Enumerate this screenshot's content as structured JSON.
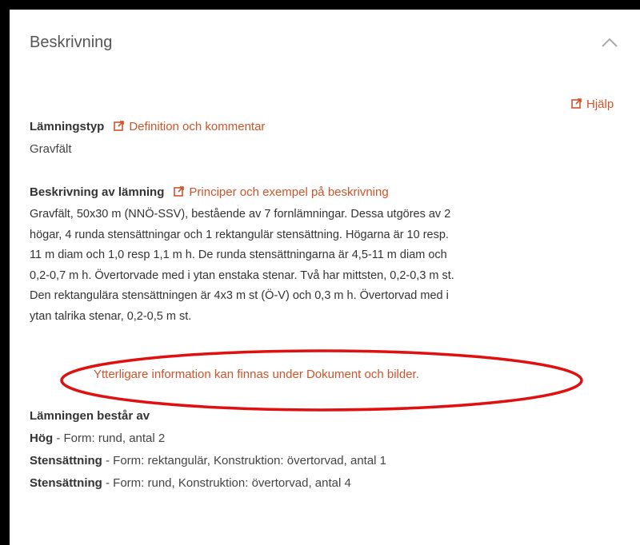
{
  "header": {
    "title": "Beskrivning"
  },
  "help_link": "Hjälp",
  "lamningstyp": {
    "label": "Lämningstyp",
    "link": "Definition och kommentar",
    "value": "Gravfält"
  },
  "beskrivning": {
    "label": "Beskrivning av lämning",
    "link": "Principer och exempel på beskrivning",
    "lines": [
      "Gravfält, 50x30 m (NNÖ-SSV), bestående av 7 fornlämningar. Dessa utgöres av 2",
      "högar, 4 runda stensättningar och 1 rektangulär stensättning. Högarna är 10 resp.",
      "11 m diam och 1,0 resp 1,1 m h. De runda stensättningarna är 4,5-11 m diam och",
      "0,2-0,7 m h. Övertorvade med i ytan enstaka stenar. Två har mittsten, 0,2-0,3 m st.",
      "Den rektangulära stensättningen är 4x3 m st (Ö-V) och 0,3 m h. Övertorvad med i",
      "ytan talrika stenar, 0,2-0,5 m st."
    ]
  },
  "note": "Ytterligare information kan finnas under Dokument och bilder.",
  "bestar": {
    "label": "Lämningen består av",
    "items": [
      {
        "name": "Hög",
        "detail": " - Form: rund, antal 2"
      },
      {
        "name": "Stensättning",
        "detail": " - Form: rektangulär, Konstruktion: övertorvad, antal 1"
      },
      {
        "name": "Stensättning",
        "detail": " - Form: rund, Konstruktion: övertorvad, antal 4"
      }
    ]
  },
  "colors": {
    "link": "#d0532a",
    "annotation": "#e01010"
  },
  "icons": {
    "collapse": "chevron-up-icon",
    "external": "external-link-icon"
  }
}
